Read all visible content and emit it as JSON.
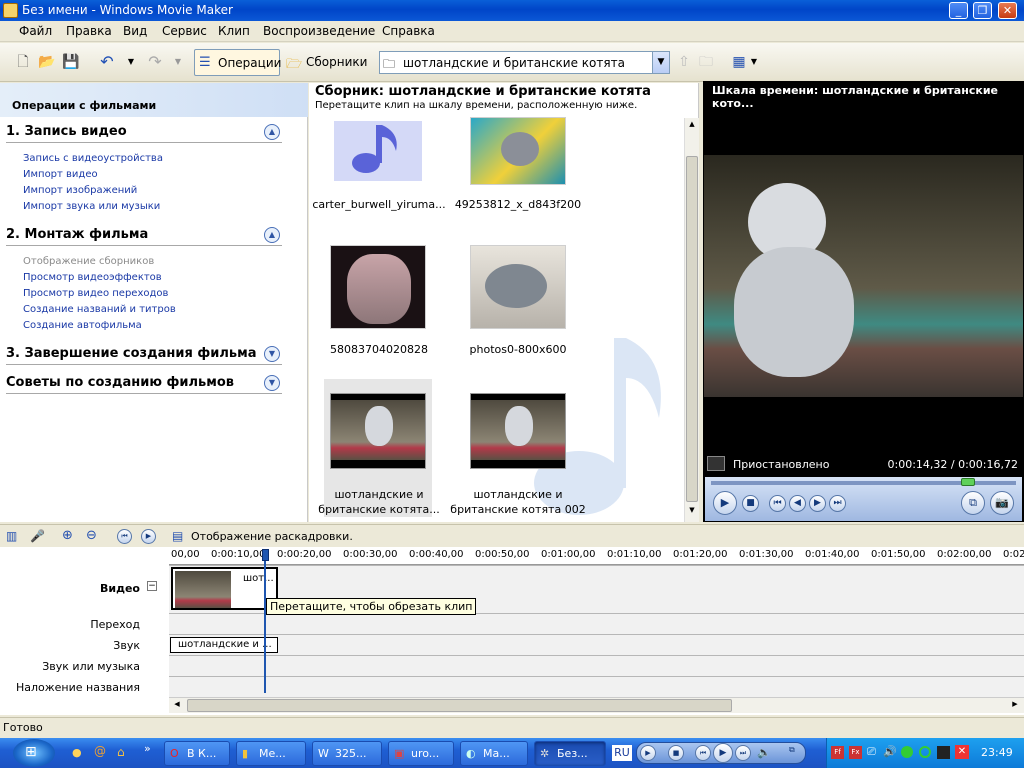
{
  "window": {
    "title": "Без имени - Windows Movie Maker"
  },
  "menu": [
    "Файл",
    "Правка",
    "Вид",
    "Сервис",
    "Клип",
    "Воспроизведение",
    "Справка"
  ],
  "toolbar": {
    "operations_label": "Операции",
    "collections_label": "Сборники",
    "collection_select": "шотландские и британские котята"
  },
  "taskpane": {
    "header": "Операции с фильмами",
    "sections": [
      {
        "title": "1. Запись видео",
        "links": [
          "Запись с видеоустройства",
          "Импорт видео",
          "Импорт изображений",
          "Импорт звука или музыки"
        ]
      },
      {
        "title": "2. Монтаж фильма",
        "links": [
          "Отображение сборников",
          "Просмотр видеоэффектов",
          "Просмотр видео переходов",
          "Создание названий и титров",
          "Создание автофильма"
        ]
      },
      {
        "title": "3. Завершение создания фильма",
        "links": []
      },
      {
        "title": "Советы по созданию фильмов",
        "links": []
      }
    ]
  },
  "collection": {
    "title": "Сборник: шотландские и британские котята",
    "subtitle": "Перетащите клип на шкалу времени, расположенную ниже.",
    "items": [
      {
        "label": "carter_burwell_yiruma..."
      },
      {
        "label": "49253812_x_d843f200"
      },
      {
        "label": "58083704020828"
      },
      {
        "label": "photos0-800x600"
      },
      {
        "label": "шотландские и британские котята..."
      },
      {
        "label": "шотландские и британские котята 002"
      }
    ]
  },
  "preview": {
    "title": "Шкала времени: шотландские и британские кото...",
    "status": "Приостановлено",
    "time": "0:00:14,32 / 0:00:16,72",
    "progress": 0.86
  },
  "timeline": {
    "toolbar_label": "Отображение раскадровки.",
    "ruler": [
      "00,00",
      "0:00:10,00",
      "0:00:20,00",
      "0:00:30,00",
      "0:00:40,00",
      "0:00:50,00",
      "0:01:00,00",
      "0:01:10,00",
      "0:01:20,00",
      "0:01:30,00",
      "0:01:40,00",
      "0:01:50,00",
      "0:02:00,00",
      "0:02"
    ],
    "tracks": [
      "Видео",
      "Переход",
      "Звук",
      "Звук или музыка",
      "Наложение названия"
    ],
    "video_clip_label": "шот...",
    "audio_clip_label": "шотландские и ...",
    "tooltip": "Перетащите, чтобы обрезать клип"
  },
  "statusbar": {
    "text": "Готово"
  },
  "taskbar": {
    "buttons": [
      "В К...",
      "Ме...",
      "325...",
      "uro...",
      "Ma...",
      "Без..."
    ],
    "lang": "RU",
    "clock": "23:49"
  },
  "colors": {
    "title_blue": "#0a5fd8",
    "link_blue": "#1a39a6",
    "taskbar_blue": "#1f5fd3",
    "playhead": "#1f56b0"
  }
}
